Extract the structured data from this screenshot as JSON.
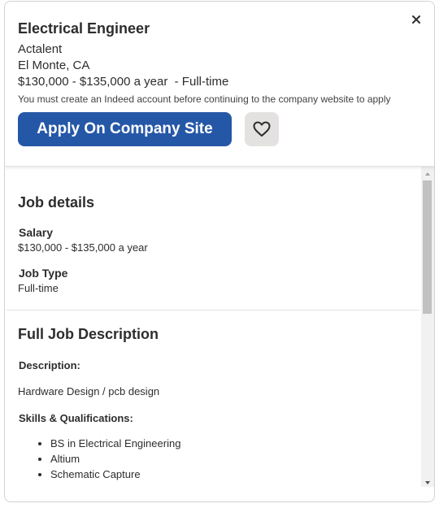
{
  "header": {
    "title": "Electrical Engineer",
    "company": "Actalent",
    "location": "El Monte, CA",
    "salary_line": "$130,000 - $135,000 a year  - Full-time",
    "notice": "You must create an Indeed account before continuing to the company website to apply",
    "apply_label": "Apply On Company Site",
    "close_icon": "close-icon",
    "save_icon": "heart-icon"
  },
  "job_details": {
    "heading": "Job details",
    "salary_label": "Salary",
    "salary_value": "$130,000 - $135,000 a year",
    "type_label": "Job Type",
    "type_value": "Full-time"
  },
  "description": {
    "heading": "Full Job Description",
    "desc_label": "Description:",
    "desc_text": "Hardware Design / pcb design",
    "skills_label": "Skills & Qualifications:",
    "skills": [
      "BS in Electrical Engineering",
      "Altium",
      "Schematic Capture"
    ]
  },
  "colors": {
    "accent": "#2557a7",
    "save_bg": "#e4e2e0"
  }
}
